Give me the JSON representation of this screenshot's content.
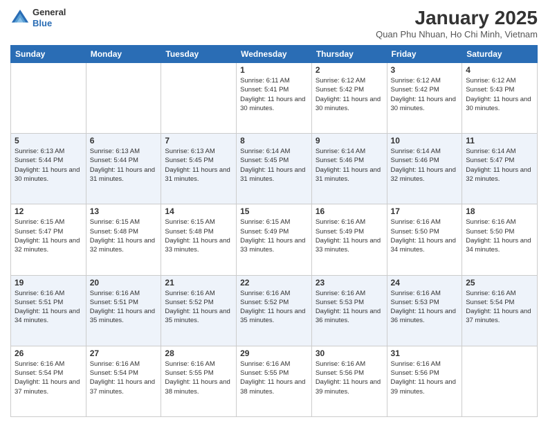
{
  "header": {
    "logo_line1": "General",
    "logo_line2": "Blue",
    "title": "January 2025",
    "subtitle": "Quan Phu Nhuan, Ho Chi Minh, Vietnam"
  },
  "days_of_week": [
    "Sunday",
    "Monday",
    "Tuesday",
    "Wednesday",
    "Thursday",
    "Friday",
    "Saturday"
  ],
  "weeks": [
    [
      {
        "day": "",
        "sunrise": "",
        "sunset": "",
        "daylight": ""
      },
      {
        "day": "",
        "sunrise": "",
        "sunset": "",
        "daylight": ""
      },
      {
        "day": "",
        "sunrise": "",
        "sunset": "",
        "daylight": ""
      },
      {
        "day": "1",
        "sunrise": "Sunrise: 6:11 AM",
        "sunset": "Sunset: 5:41 PM",
        "daylight": "Daylight: 11 hours and 30 minutes."
      },
      {
        "day": "2",
        "sunrise": "Sunrise: 6:12 AM",
        "sunset": "Sunset: 5:42 PM",
        "daylight": "Daylight: 11 hours and 30 minutes."
      },
      {
        "day": "3",
        "sunrise": "Sunrise: 6:12 AM",
        "sunset": "Sunset: 5:42 PM",
        "daylight": "Daylight: 11 hours and 30 minutes."
      },
      {
        "day": "4",
        "sunrise": "Sunrise: 6:12 AM",
        "sunset": "Sunset: 5:43 PM",
        "daylight": "Daylight: 11 hours and 30 minutes."
      }
    ],
    [
      {
        "day": "5",
        "sunrise": "Sunrise: 6:13 AM",
        "sunset": "Sunset: 5:44 PM",
        "daylight": "Daylight: 11 hours and 30 minutes."
      },
      {
        "day": "6",
        "sunrise": "Sunrise: 6:13 AM",
        "sunset": "Sunset: 5:44 PM",
        "daylight": "Daylight: 11 hours and 31 minutes."
      },
      {
        "day": "7",
        "sunrise": "Sunrise: 6:13 AM",
        "sunset": "Sunset: 5:45 PM",
        "daylight": "Daylight: 11 hours and 31 minutes."
      },
      {
        "day": "8",
        "sunrise": "Sunrise: 6:14 AM",
        "sunset": "Sunset: 5:45 PM",
        "daylight": "Daylight: 11 hours and 31 minutes."
      },
      {
        "day": "9",
        "sunrise": "Sunrise: 6:14 AM",
        "sunset": "Sunset: 5:46 PM",
        "daylight": "Daylight: 11 hours and 31 minutes."
      },
      {
        "day": "10",
        "sunrise": "Sunrise: 6:14 AM",
        "sunset": "Sunset: 5:46 PM",
        "daylight": "Daylight: 11 hours and 32 minutes."
      },
      {
        "day": "11",
        "sunrise": "Sunrise: 6:14 AM",
        "sunset": "Sunset: 5:47 PM",
        "daylight": "Daylight: 11 hours and 32 minutes."
      }
    ],
    [
      {
        "day": "12",
        "sunrise": "Sunrise: 6:15 AM",
        "sunset": "Sunset: 5:47 PM",
        "daylight": "Daylight: 11 hours and 32 minutes."
      },
      {
        "day": "13",
        "sunrise": "Sunrise: 6:15 AM",
        "sunset": "Sunset: 5:48 PM",
        "daylight": "Daylight: 11 hours and 32 minutes."
      },
      {
        "day": "14",
        "sunrise": "Sunrise: 6:15 AM",
        "sunset": "Sunset: 5:48 PM",
        "daylight": "Daylight: 11 hours and 33 minutes."
      },
      {
        "day": "15",
        "sunrise": "Sunrise: 6:15 AM",
        "sunset": "Sunset: 5:49 PM",
        "daylight": "Daylight: 11 hours and 33 minutes."
      },
      {
        "day": "16",
        "sunrise": "Sunrise: 6:16 AM",
        "sunset": "Sunset: 5:49 PM",
        "daylight": "Daylight: 11 hours and 33 minutes."
      },
      {
        "day": "17",
        "sunrise": "Sunrise: 6:16 AM",
        "sunset": "Sunset: 5:50 PM",
        "daylight": "Daylight: 11 hours and 34 minutes."
      },
      {
        "day": "18",
        "sunrise": "Sunrise: 6:16 AM",
        "sunset": "Sunset: 5:50 PM",
        "daylight": "Daylight: 11 hours and 34 minutes."
      }
    ],
    [
      {
        "day": "19",
        "sunrise": "Sunrise: 6:16 AM",
        "sunset": "Sunset: 5:51 PM",
        "daylight": "Daylight: 11 hours and 34 minutes."
      },
      {
        "day": "20",
        "sunrise": "Sunrise: 6:16 AM",
        "sunset": "Sunset: 5:51 PM",
        "daylight": "Daylight: 11 hours and 35 minutes."
      },
      {
        "day": "21",
        "sunrise": "Sunrise: 6:16 AM",
        "sunset": "Sunset: 5:52 PM",
        "daylight": "Daylight: 11 hours and 35 minutes."
      },
      {
        "day": "22",
        "sunrise": "Sunrise: 6:16 AM",
        "sunset": "Sunset: 5:52 PM",
        "daylight": "Daylight: 11 hours and 35 minutes."
      },
      {
        "day": "23",
        "sunrise": "Sunrise: 6:16 AM",
        "sunset": "Sunset: 5:53 PM",
        "daylight": "Daylight: 11 hours and 36 minutes."
      },
      {
        "day": "24",
        "sunrise": "Sunrise: 6:16 AM",
        "sunset": "Sunset: 5:53 PM",
        "daylight": "Daylight: 11 hours and 36 minutes."
      },
      {
        "day": "25",
        "sunrise": "Sunrise: 6:16 AM",
        "sunset": "Sunset: 5:54 PM",
        "daylight": "Daylight: 11 hours and 37 minutes."
      }
    ],
    [
      {
        "day": "26",
        "sunrise": "Sunrise: 6:16 AM",
        "sunset": "Sunset: 5:54 PM",
        "daylight": "Daylight: 11 hours and 37 minutes."
      },
      {
        "day": "27",
        "sunrise": "Sunrise: 6:16 AM",
        "sunset": "Sunset: 5:54 PM",
        "daylight": "Daylight: 11 hours and 37 minutes."
      },
      {
        "day": "28",
        "sunrise": "Sunrise: 6:16 AM",
        "sunset": "Sunset: 5:55 PM",
        "daylight": "Daylight: 11 hours and 38 minutes."
      },
      {
        "day": "29",
        "sunrise": "Sunrise: 6:16 AM",
        "sunset": "Sunset: 5:55 PM",
        "daylight": "Daylight: 11 hours and 38 minutes."
      },
      {
        "day": "30",
        "sunrise": "Sunrise: 6:16 AM",
        "sunset": "Sunset: 5:56 PM",
        "daylight": "Daylight: 11 hours and 39 minutes."
      },
      {
        "day": "31",
        "sunrise": "Sunrise: 6:16 AM",
        "sunset": "Sunset: 5:56 PM",
        "daylight": "Daylight: 11 hours and 39 minutes."
      },
      {
        "day": "",
        "sunrise": "",
        "sunset": "",
        "daylight": ""
      }
    ]
  ]
}
